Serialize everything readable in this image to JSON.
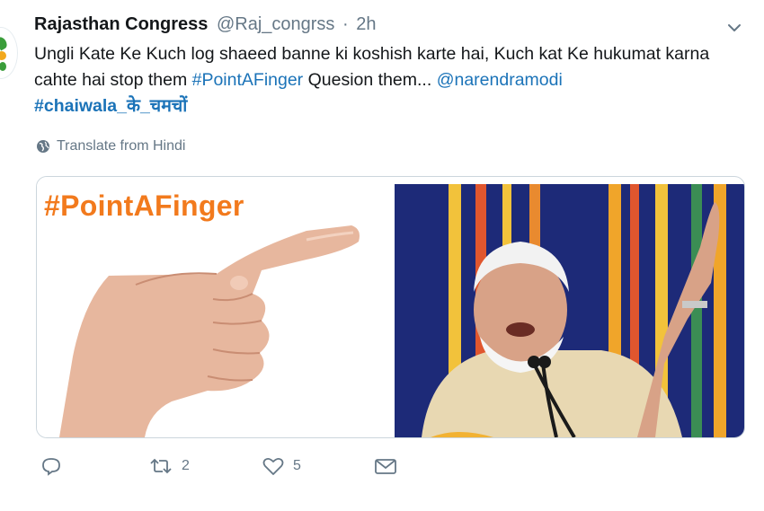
{
  "tweet": {
    "author_name": "Rajasthan Congress",
    "handle": "@Raj_congrss",
    "separator": "·",
    "time": "2h",
    "text_part1": "Ungli Kate Ke Kuch log shaeed banne ki koshish karte hai, Kuch kat Ke hukumat karna cahte hai stop them ",
    "hashtag1": "#PointAFinger",
    "text_part2": " Quesion them... ",
    "mention": "@narendramodi",
    "hashtag2": "#chaiwala_के_चमचों",
    "translate_label": "Translate from Hindi"
  },
  "media": {
    "left_title": "#PointAFinger"
  },
  "actions": {
    "reply_icon": "reply-icon",
    "retweet_icon": "retweet-icon",
    "retweet_count": "2",
    "like_icon": "heart-icon",
    "like_count": "5",
    "dm_icon": "envelope-icon"
  },
  "colors": {
    "link": "#1b73b8",
    "secondary_text": "#657786",
    "poster_orange": "#f27a1d"
  }
}
